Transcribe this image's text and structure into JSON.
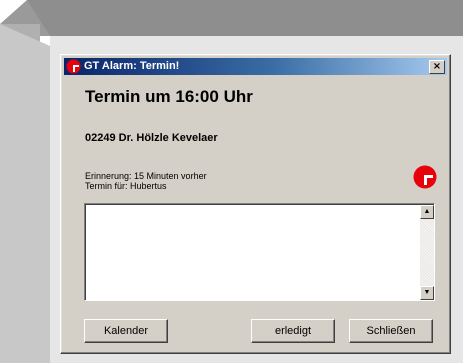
{
  "window": {
    "title": "GT Alarm: Termin!",
    "close_label": "×"
  },
  "appointment": {
    "heading": "Termin um 16:00 Uhr",
    "address": "02249 Dr. Hölzle Kevelaer",
    "reminder": "Erinnerung: 15 Minuten vorher",
    "for_whom": "Termin für: Hubertus"
  },
  "notes": {
    "text": ""
  },
  "buttons": {
    "calendar": "Kalender",
    "done": "erledigt",
    "close": "Schließen"
  },
  "colors": {
    "title_start": "#0a246a",
    "title_end": "#a6caf0",
    "face": "#d4d0c8",
    "logo_red": "#e8000b"
  }
}
